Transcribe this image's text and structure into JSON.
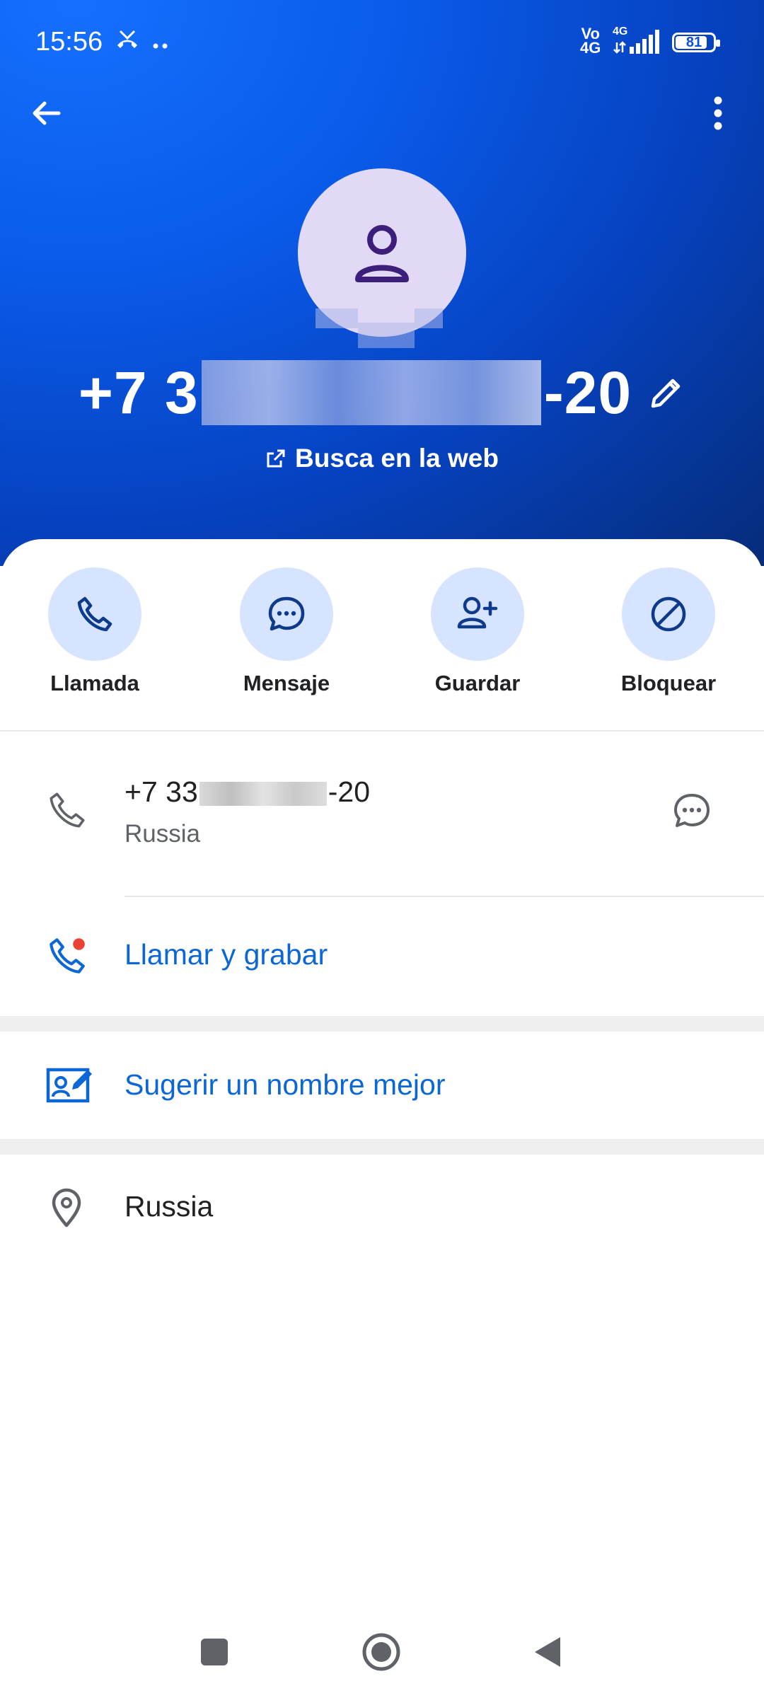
{
  "status_bar": {
    "time": "15:56",
    "network_top": "Vo",
    "network_bottom": "4G",
    "signal_label": "4G",
    "battery": "81"
  },
  "header": {
    "phone_prefix": "+7 3",
    "phone_suffix": "-20",
    "web_search": "Busca en la web"
  },
  "actions": [
    {
      "label": "Llamada",
      "icon": "phone-icon"
    },
    {
      "label": "Mensaje",
      "icon": "message-icon"
    },
    {
      "label": "Guardar",
      "icon": "add-person-icon"
    },
    {
      "label": "Bloquear",
      "icon": "block-icon"
    }
  ],
  "details": {
    "phone_prefix": "+7 33",
    "phone_suffix": "-20",
    "phone_country": "Russia",
    "call_record": "Llamar y grabar",
    "suggest_name": "Sugerir un nombre mejor",
    "location": "Russia"
  },
  "colors": {
    "header_blue": "#0a5ae8",
    "accent_blue": "#0b66d6",
    "action_bg": "#d6e4ff",
    "avatar_bg": "#e2d9f7",
    "avatar_icon": "#3b1f7a",
    "record_dot": "#ea4335"
  }
}
